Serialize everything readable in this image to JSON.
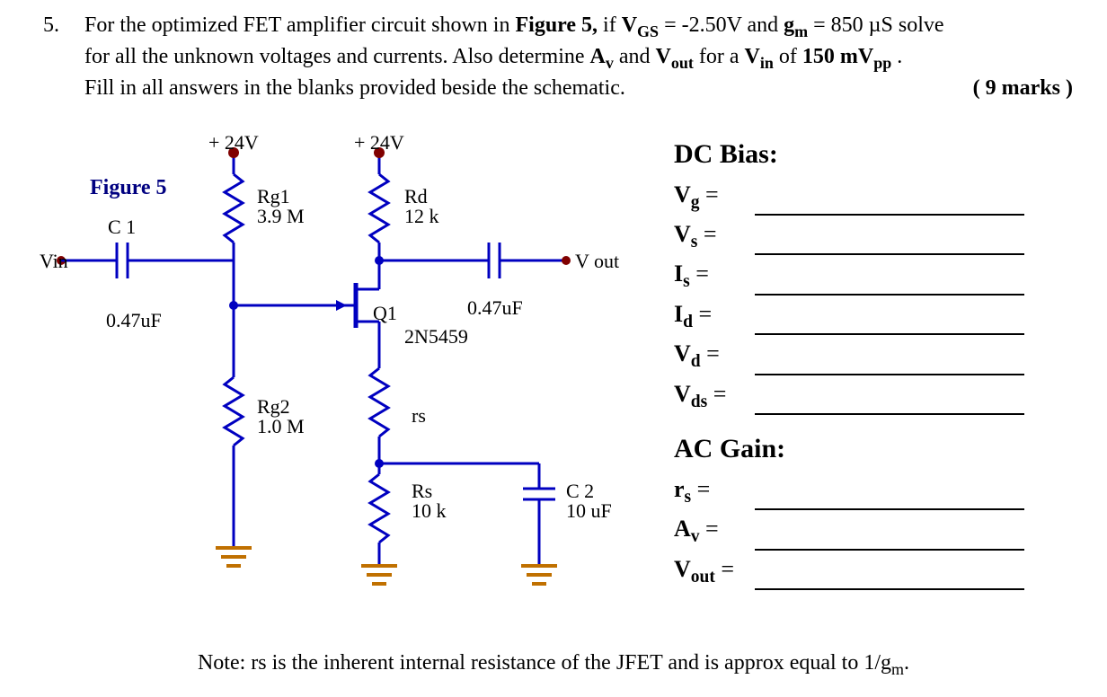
{
  "question": {
    "number": "5.",
    "text_l1a": "For the optimized FET amplifier circuit shown in ",
    "figref": "Figure 5,",
    "text_l1b": " if ",
    "vgs_sym_pre": "V",
    "vgs_sym_sub": "GS",
    "vgs_expr": " = -2.50V and ",
    "gm_sym_pre": "g",
    "gm_sym_sub": "m",
    "gm_expr": " = 850 µS solve",
    "text_l2a": "for all the unknown voltages and currents.  Also determine ",
    "av_pre": "A",
    "av_sub": "v",
    "text_l2b": " and ",
    "vout_pre": "V",
    "vout_sub": "out",
    "text_l2c": " for a ",
    "vin_pre": "V",
    "vin_sub": "in",
    "text_l2d": " of  ",
    "vin_val": "150 mV",
    "vin_suffix": "pp",
    "text_l2e": ".",
    "text_l3": "Fill in all answers in the blanks provided beside the schematic.",
    "marks": "( 9 marks )"
  },
  "figure": {
    "label": "Figure 5",
    "supply1": "+ 24V",
    "supply2": "+ 24V",
    "Vin": "Vin",
    "Vout": "V out",
    "C1_name": "C 1",
    "C1_val": "0.47uF",
    "Cout_val": "0.47uF",
    "C2_name": "C 2",
    "C2_val": "10 uF",
    "Rg1_name": "Rg1",
    "Rg1_val": "3.9 M",
    "Rg2_name": "Rg2",
    "Rg2_val": "1.0 M",
    "Rd_name": "Rd",
    "Rd_val": "12 k",
    "Rs_name": "Rs",
    "Rs_val": "10 k",
    "rs_name": "rs",
    "Q1_name": "Q1",
    "Q1_part": "2N5459"
  },
  "answers": {
    "dc_heading": "DC Bias:",
    "ac_heading": "AC Gain:",
    "Vg": "V",
    "Vg_sub": "g",
    "Vs": "V",
    "Vs_sub": "s",
    "Is": "I",
    "Is_sub": "s",
    "Id": "I",
    "Id_sub": "d",
    "Vd": "V",
    "Vd_sub": "d",
    "Vds": "V",
    "Vds_sub": "ds",
    "rs": "r",
    "rs_sub": "s",
    "Av": "A",
    "Av_sub": "v",
    "Vout": "V",
    "Vout_sub": "out",
    "eq": " ="
  },
  "note": {
    "a": "Note: rs is the inherent internal resistance of the JFET and is approx equal to 1/g",
    "sub": "m",
    "b": "."
  }
}
